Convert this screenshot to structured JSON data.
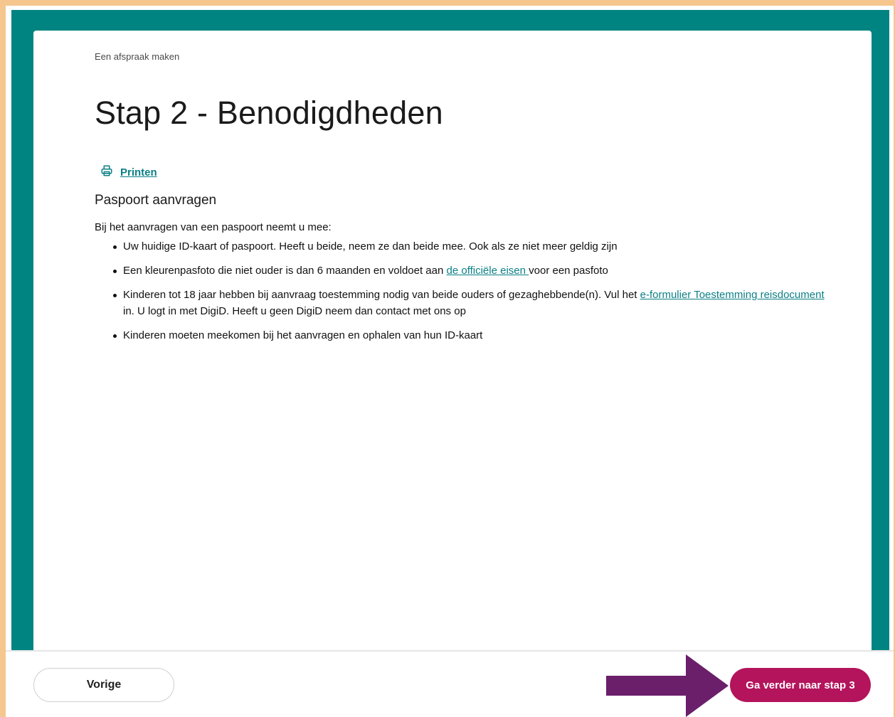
{
  "breadcrumb": "Een afspraak maken",
  "page_title": "Stap 2 - Benodigdheden",
  "print_label": "Printen",
  "section_title": "Paspoort aanvragen",
  "intro": "Bij het aanvragen van een paspoort neemt u mee:",
  "items": {
    "one": "Uw huidige ID-kaart of paspoort. Heeft u beide, neem ze dan beide mee. Ook als ze niet meer geldig zijn",
    "two_before": "Een kleurenpasfoto die niet ouder is dan 6 maanden en voldoet aan ",
    "two_link": "de officiële eisen ",
    "two_after": "voor een pasfoto",
    "three_before": "Kinderen tot 18 jaar hebben bij aanvraag toestemming nodig van beide ouders of gezaghebbende(n). Vul het ",
    "three_link": "e-formulier Toestemming reisdocument ",
    "three_after": "in. U logt in met DigiD. Heeft u geen DigiD neem dan contact met ons op",
    "four": "Kinderen moeten meekomen bij het aanvragen en ophalen van hun ID-kaart"
  },
  "buttons": {
    "previous": "Vorige",
    "next": "Ga verder naar stap 3"
  },
  "icons": {
    "print": "printer-icon",
    "annotation": "arrow-right-icon"
  },
  "colors": {
    "teal": "#008482",
    "link": "#0b7f85",
    "next_button": "#b3145c",
    "outer_border": "#f5c68d",
    "arrow": "#6b1f6b"
  }
}
